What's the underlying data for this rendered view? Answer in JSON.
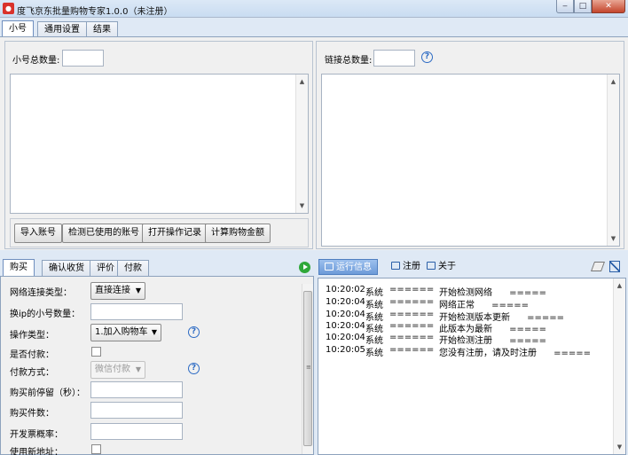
{
  "window": {
    "title": "度飞京东批量购物专家1.0.0（未注册）",
    "icon": "app-red-icon",
    "controls": {
      "minimize": "‒",
      "maximize": "□",
      "close": "✕"
    }
  },
  "top_tabs": [
    "小号",
    "通用设置",
    "结果"
  ],
  "accounts_panel": {
    "count_label": "小号总数量:",
    "count_value": "",
    "buttons": [
      "导入账号",
      "检测已使用的账号",
      "打开操作记录",
      "计算购物金额"
    ]
  },
  "links_panel": {
    "count_label": "链接总数量:",
    "count_value": "",
    "help": "?"
  },
  "bottom_left_tabs": [
    "购买",
    "确认收货",
    "评价",
    "付款"
  ],
  "purchase_form": {
    "network_type_label": "网络连接类型：",
    "network_type_value": "直接连接",
    "ip_switch_label": "换ip的小号数量：",
    "ip_switch_value": "",
    "operation_type_label": "操作类型：",
    "operation_type_value": "1.加入购物车",
    "pay_label": "是否付款：",
    "pay_method_label": "付款方式：",
    "pay_method_value": "微信付款",
    "wait_label": "购买前停留（秒）：",
    "wait_value": "",
    "quantity_label": "购买件数：",
    "quantity_value": "",
    "invoice_label": "开发票概率：",
    "invoice_value": "",
    "new_address_label": "使用新地址："
  },
  "bottom_right_tabs": [
    "运行信息",
    "注册",
    "关于"
  ],
  "log": [
    {
      "time": "10:20:02",
      "source": "系统",
      "sep": "======",
      "message": "开始检测网络      ====="
    },
    {
      "time": "10:20:04",
      "source": "系统",
      "sep": "======",
      "message": "网络正常      ====="
    },
    {
      "time": "10:20:04",
      "source": "系统",
      "sep": "======",
      "message": "开始检测版本更新      ====="
    },
    {
      "time": "10:20:04",
      "source": "系统",
      "sep": "======",
      "message": "此版本为最新      ====="
    },
    {
      "time": "10:20:04",
      "source": "系统",
      "sep": "======",
      "message": "开始检测注册      ====="
    },
    {
      "time": "10:20:05",
      "source": "系统",
      "sep": "======",
      "message": "您没有注册，请及时注册      ====="
    }
  ],
  "colors": {
    "accent": "#2d6bc4",
    "run_green": "#2fa83a",
    "title_icon": "#d9322b"
  }
}
